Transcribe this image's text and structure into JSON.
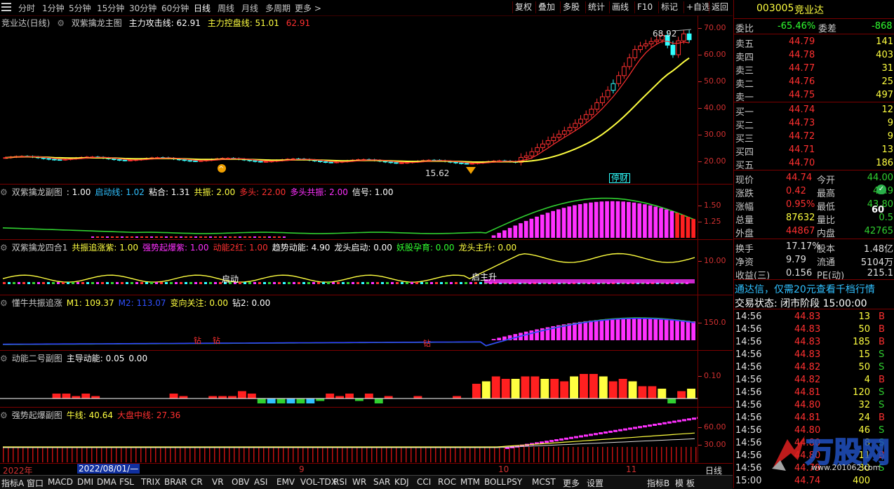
{
  "toolbar": {
    "timeframes": [
      "分时",
      "1分钟",
      "5分钟",
      "15分钟",
      "30分钟",
      "60分钟",
      "日线",
      "周线",
      "月线",
      "多周期",
      "更多 >"
    ],
    "right_buttons": [
      "复权",
      "叠加",
      "多股",
      "统计",
      "画线",
      "F10",
      "标记",
      "+自选",
      "返回"
    ]
  },
  "main_chart": {
    "title": "竞业达(日线)",
    "indicator": "双紫擒龙主图",
    "l1_label": "主力攻击线: 62.91",
    "l2_label": "主力控盘线: 51.01",
    "l3_label": "62.91",
    "high_label": "68.92",
    "low_label": "15.62",
    "stop_label": "停财",
    "y_ticks": [
      "70.00",
      "60.00",
      "50.00",
      "40.00",
      "30.00",
      "20.00"
    ]
  },
  "sub1": {
    "name": "双紫擒龙副图",
    "items": [
      ": 1.00",
      "启动线: 1.02",
      "粘合: 1.31",
      "共振: 2.00",
      "多头: 22.00",
      "多头共振: 2.00",
      "信号: 1.00"
    ],
    "y_ticks": [
      "1.50",
      "1.25"
    ]
  },
  "sub2": {
    "name": "双紫擒龙四合1",
    "items": [
      "共振追涨紫: 1.00",
      "强势起爆紫: 1.00",
      "动能2红: 1.00",
      "趋势动能: 4.90",
      "龙头启动: 0.00",
      "妖股孕育: 0.00",
      "龙头主升: 0.00"
    ],
    "annot1": "启动",
    "annot2": "启主升",
    "y_ticks": [
      "10.00"
    ]
  },
  "sub3": {
    "name": "懂牛共振追涨",
    "items": [
      "M1: 109.37",
      "M2: 113.07",
      "变向关注: 0.00",
      "钻2: 0.00"
    ],
    "diamond": "钻",
    "y_ticks": [
      "150.0"
    ]
  },
  "sub4": {
    "name": "动能二号副图",
    "items": [
      "主导动能: 0.05",
      "0.00"
    ],
    "y_ticks": [
      "0.10"
    ]
  },
  "sub5": {
    "name": "强势起爆副图",
    "items": [
      "牛线: 40.64",
      "大盘中线: 27.36"
    ],
    "y_ticks": [
      "60.00",
      "30.00"
    ]
  },
  "datebar": {
    "year": "2022年",
    "cursor_date": "2022/08/01/—",
    "months": [
      "9",
      "10",
      "11"
    ],
    "period": "日线"
  },
  "tabs": [
    "指标A",
    "窗口",
    "MACD",
    "DMI",
    "DMA",
    "FSL",
    "TRIX",
    "BRAR",
    "CR",
    "VR",
    "OBV",
    "ASI",
    "EMV",
    "VOL-TDX",
    "RSI",
    "WR",
    "SAR",
    "KDJ",
    "CCI",
    "ROC",
    "MTM",
    "BOLL",
    "PSY",
    "MCST",
    "更多",
    "设置",
    "指标B",
    "模",
    "板"
  ],
  "quote": {
    "code": "003005",
    "name": "竞业达",
    "webi_label": "委比",
    "webi": "-65.46%",
    "weicha_label": "委差",
    "weicha": "-868",
    "asks": [
      {
        "label": "卖五",
        "price": "44.79",
        "vol": "141"
      },
      {
        "label": "卖四",
        "price": "44.78",
        "vol": "403"
      },
      {
        "label": "卖三",
        "price": "44.77",
        "vol": "31"
      },
      {
        "label": "卖二",
        "price": "44.76",
        "vol": "25"
      },
      {
        "label": "卖一",
        "price": "44.75",
        "vol": "497"
      }
    ],
    "bids": [
      {
        "label": "买一",
        "price": "44.74",
        "vol": "12"
      },
      {
        "label": "买二",
        "price": "44.73",
        "vol": "9"
      },
      {
        "label": "买三",
        "price": "44.72",
        "vol": "9"
      },
      {
        "label": "买四",
        "price": "44.71",
        "vol": "13"
      },
      {
        "label": "买五",
        "price": "44.70",
        "vol": "186"
      }
    ],
    "stats": [
      {
        "l1": "现价",
        "v1": "44.74",
        "l2": "今开",
        "v2": "44.00"
      },
      {
        "l1": "涨跌",
        "v1": "0.42",
        "l2": "最高",
        "v2": "49.9"
      },
      {
        "l1": "涨幅",
        "v1": "0.95%",
        "l2": "最低",
        "v2": "43.80"
      },
      {
        "l1": "总量",
        "v1": "87632",
        "l2": "量比",
        "v2": "0.5"
      },
      {
        "l1": "外盘",
        "v1": "44867",
        "l2": "内盘",
        "v2": "42765"
      }
    ],
    "stats2": [
      {
        "l1": "换手",
        "v1": "17.17%",
        "l2": "股本",
        "v2": "1.48亿"
      },
      {
        "l1": "净资",
        "v1": "9.79",
        "l2": "流通",
        "v2": "5104万"
      },
      {
        "l1": "收益(三)",
        "v1": "0.156",
        "l2": "PE(动)",
        "v2": "215.1"
      }
    ],
    "ad": "通达信，仅需20元查看千档行情",
    "status": "交易状态: 闭市阶段 15:00:00",
    "badge_value": "60",
    "ticks": [
      {
        "t": "14:56",
        "p": "44.83",
        "v": "13",
        "s": "B"
      },
      {
        "t": "14:56",
        "p": "44.83",
        "v": "50",
        "s": "B"
      },
      {
        "t": "14:56",
        "p": "44.83",
        "v": "185",
        "s": "B"
      },
      {
        "t": "14:56",
        "p": "44.83",
        "v": "15",
        "s": "S"
      },
      {
        "t": "14:56",
        "p": "44.82",
        "v": "50",
        "s": "S"
      },
      {
        "t": "14:56",
        "p": "44.82",
        "v": "4",
        "s": "B"
      },
      {
        "t": "14:56",
        "p": "44.81",
        "v": "120",
        "s": "S"
      },
      {
        "t": "14:56",
        "p": "44.80",
        "v": "32",
        "s": "S"
      },
      {
        "t": "14:56",
        "p": "44.81",
        "v": "24",
        "s": "B"
      },
      {
        "t": "14:56",
        "p": "44.80",
        "v": "46",
        "s": "S"
      },
      {
        "t": "14:56",
        "p": "44.80",
        "v": "8",
        "s": "S"
      },
      {
        "t": "14:56",
        "p": "44.80",
        "v": "11",
        "s": "B"
      },
      {
        "t": "14:56",
        "p": "44.79",
        "v": "30",
        "s": "S"
      },
      {
        "t": "15:00",
        "p": "44.74",
        "v": "400",
        "s": ""
      }
    ],
    "watermark": "万股网",
    "watermark_url": "www.201062.com"
  },
  "colors": {
    "up": "#ff3030",
    "down": "#30ffff",
    "yellow": "#ffff40",
    "magenta": "#ff30ff",
    "green": "#30d030",
    "blue": "#3040ff",
    "axis": "#7a0000"
  }
}
